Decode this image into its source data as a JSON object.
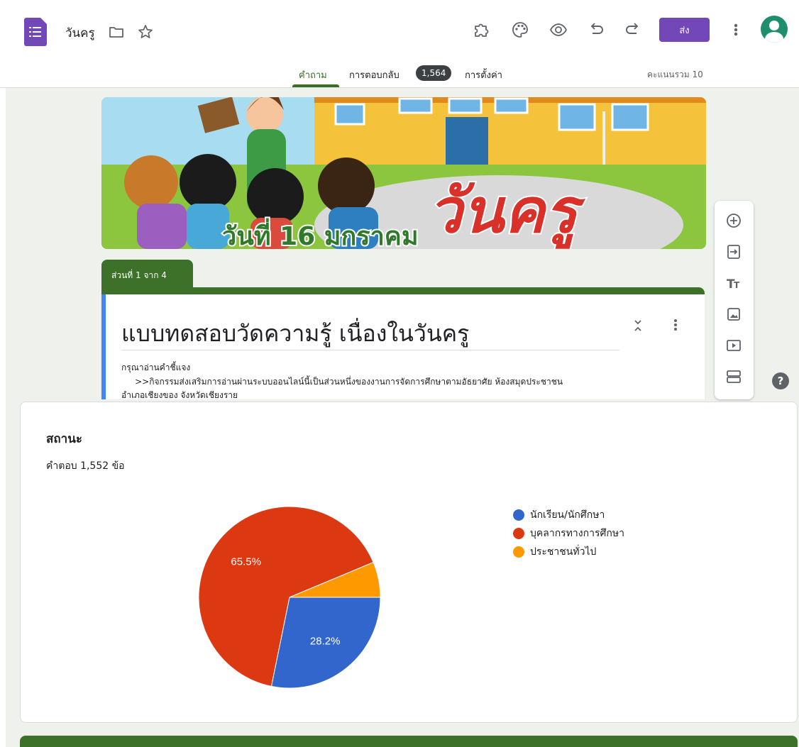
{
  "app": {
    "doc_title": "วันครู",
    "send_label": "ส่ง"
  },
  "tabs": {
    "questions": "คำถาม",
    "responses": "การตอบกลับ",
    "responses_count": "1,564",
    "settings": "การตั้งค่า",
    "total_points": "คะแนนรวม 10"
  },
  "form": {
    "header_banner_text": "วันครู",
    "header_banner_date": "วันที่ 16 มกราคม",
    "section_label": "ส่วนที่ 1 จาก 4",
    "title": "แบบทดสอบวัดความรู้ เนื่องในวันครู",
    "description_line1": "กรุณาอ่านคำชี้แจง",
    "description_line2": ">>กิจกรรมส่งเสริมการอ่านผ่านระบบออนไลน์นี้เป็นส่วนหนึ่งของงานการจัดการศึกษาตามอัธยาศัย ห้องสมุดประชาชน",
    "description_line3": "อำเภอเชียงของ จังหวัดเชียงราย"
  },
  "summary": {
    "question_title": "สถานะ",
    "response_count_text": "คำตอบ 1,552 ข้อ"
  },
  "chart_data": {
    "type": "pie",
    "categories": [
      "นักเรียน/นักศึกษา",
      "บุคลากรทางการศึกษา",
      "ประชาชนทั่วไป"
    ],
    "values": [
      28.2,
      65.5,
      6.3
    ],
    "labels": [
      "28.2%",
      "65.5%",
      ""
    ],
    "colors": [
      "#3366cc",
      "#dc3912",
      "#ff9900"
    ],
    "legend_position": "right"
  },
  "icons": {
    "app": "forms-icon",
    "folder": "folder-icon",
    "star": "star-icon",
    "addon": "puzzle-icon",
    "palette": "palette-icon",
    "preview": "eye-icon",
    "undo": "undo-icon",
    "redo": "redo-icon"
  },
  "colors": {
    "accent": "#7248b9",
    "theme": "#3d7029",
    "tab_active": "#3b6d26"
  }
}
